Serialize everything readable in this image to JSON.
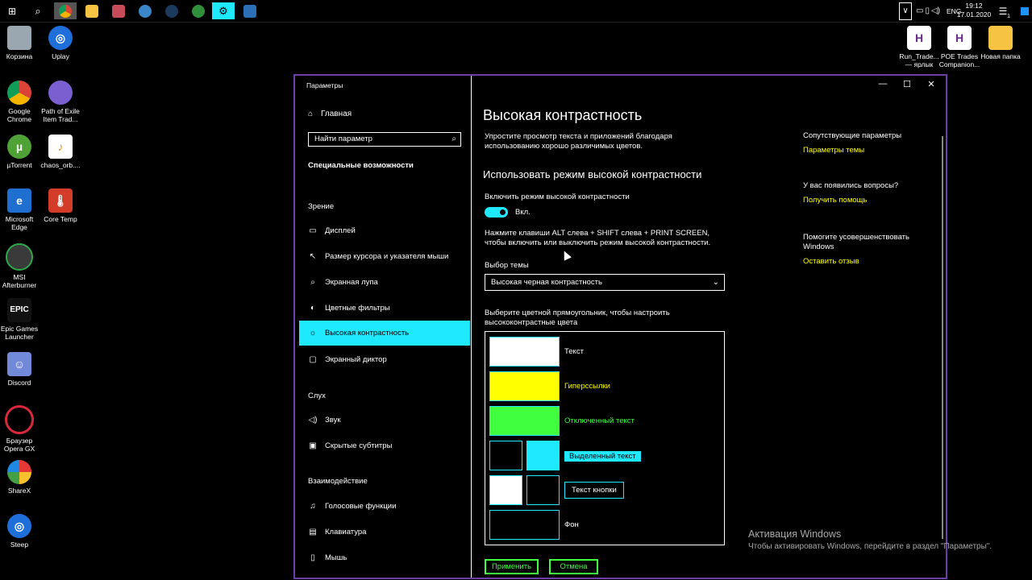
{
  "taskbar": {
    "lang": "ENG",
    "time": "19:12",
    "date": "17.01.2020",
    "notif_count": "1"
  },
  "desktop": {
    "left_icons": [
      {
        "label": "Корзина"
      },
      {
        "label": "Uplay"
      },
      {
        "label": "Google Chrome"
      },
      {
        "label": "Path of Exile Item Trad..."
      },
      {
        "label": "µTorrent"
      },
      {
        "label": "chaos_orb...."
      },
      {
        "label": "Microsoft Edge"
      },
      {
        "label": "Core Temp"
      },
      {
        "label": "MSI Afterburner"
      },
      {
        "label": "Epic Games Launcher"
      },
      {
        "label": "Discord"
      },
      {
        "label": "Браузер Opera GX"
      },
      {
        "label": "ShareX"
      },
      {
        "label": "Steep"
      }
    ],
    "right_icons": [
      {
        "label": "Run_Trade... — ярлык"
      },
      {
        "label": "POE Trades Companion..."
      },
      {
        "label": "Новая папка"
      }
    ]
  },
  "window": {
    "title": "Параметры",
    "controls": {
      "minimize": "—",
      "maximize": "☐",
      "close": "✕"
    }
  },
  "sidebar": {
    "home": "Главная",
    "search_placeholder": "Найти параметр",
    "section": "Специальные возможности",
    "group_vision": "Зрение",
    "vision_items": [
      "Дисплей",
      "Размер курсора и указателя мыши",
      "Экранная лупа",
      "Цветные фильтры",
      "Высокая контрастность",
      "Экранный диктор"
    ],
    "group_hearing": "Слух",
    "hearing_items": [
      "Звук",
      "Скрытые субтитры"
    ],
    "group_interaction": "Взаимодействие",
    "interaction_items": [
      "Голосовые функции",
      "Клавиатура",
      "Мышь"
    ]
  },
  "content": {
    "title": "Высокая контрастность",
    "description": "Упростите просмотр текста и приложений благодаря использованию хорошо различимых цветов.",
    "section_title": "Использовать режим высокой контрастности",
    "toggle_label": "Включить режим высокой контрастности",
    "toggle_state": "Вкл.",
    "hotkey_hint": "Нажмите клавиши ALT слева + SHIFT слева + PRINT SCREEN, чтобы включить или выключить режим высокой контрастности.",
    "theme_label": "Выбор темы",
    "theme_value": "Высокая черная контрастность",
    "palette_hint": "Выберите цветной прямоугольник, чтобы настроить высококонтрастные цвета",
    "palette": {
      "text": "Текст",
      "hyperlinks": "Гиперссылки",
      "disabled": "Отключенный текст",
      "selected": "Выделенный текст",
      "button": "Текст кнопки",
      "background": "Фон"
    },
    "apply": "Применить",
    "cancel": "Отмена"
  },
  "related": {
    "title": "Сопутствующие параметры",
    "link": "Параметры темы",
    "questions": "У вас появились вопросы?",
    "help": "Получить помощь",
    "improve": "Помогите усовершенствовать Windows",
    "feedback": "Оставить отзыв"
  },
  "watermark": {
    "line1": "Активация Windows",
    "line2": "Чтобы активировать Windows, перейдите в раздел \"Параметры\"."
  },
  "colors": {
    "accent": "#1ee9ff",
    "hyperlink": "#ffff00",
    "disabled": "#3fff3f",
    "window_border": "#6c3fa8"
  }
}
